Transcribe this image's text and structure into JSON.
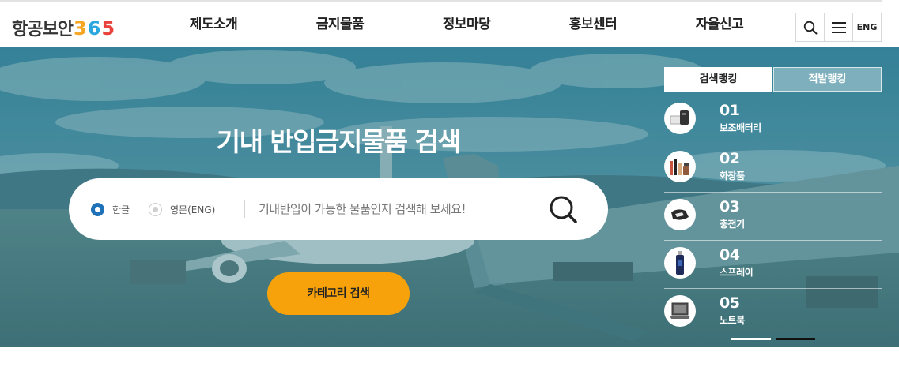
{
  "header": {
    "logo": {
      "text": "항공보안",
      "digits": [
        {
          "char": "3",
          "color": "#f5a623"
        },
        {
          "char": "6",
          "color": "#2aa7df"
        },
        {
          "char": "5",
          "color": "#e8423c"
        }
      ]
    },
    "menu": [
      "제도소개",
      "금지물품",
      "정보마당",
      "홍보센터",
      "자율신고"
    ],
    "utils": {
      "search_icon": "search-icon",
      "menu_icon": "hamburger-icon",
      "lang": "ENG"
    }
  },
  "hero": {
    "title": "기내 반입금지물품 검색",
    "search": {
      "options": [
        {
          "label": "한글",
          "selected": true
        },
        {
          "label": "영문(ENG)",
          "selected": false
        }
      ],
      "placeholder": "기내반입이 가능한 물품인지 검색해 보세요!",
      "value": ""
    },
    "category_button": "카테고리 검색"
  },
  "ranking": {
    "tabs": [
      {
        "label": "검색랭킹",
        "active": true
      },
      {
        "label": "적발랭킹",
        "active": false
      }
    ],
    "items": [
      {
        "rank": "01",
        "name": "보조배터리",
        "icon": "power-bank-icon"
      },
      {
        "rank": "02",
        "name": "화장품",
        "icon": "cosmetics-icon"
      },
      {
        "rank": "03",
        "name": "충전기",
        "icon": "charger-icon"
      },
      {
        "rank": "04",
        "name": "스프레이",
        "icon": "spray-icon"
      },
      {
        "rank": "05",
        "name": "노트북",
        "icon": "laptop-icon"
      }
    ]
  },
  "colors": {
    "accent_orange": "#f7a20a",
    "radio_blue": "#1f72b8",
    "hero_tint": "#105a6e"
  }
}
